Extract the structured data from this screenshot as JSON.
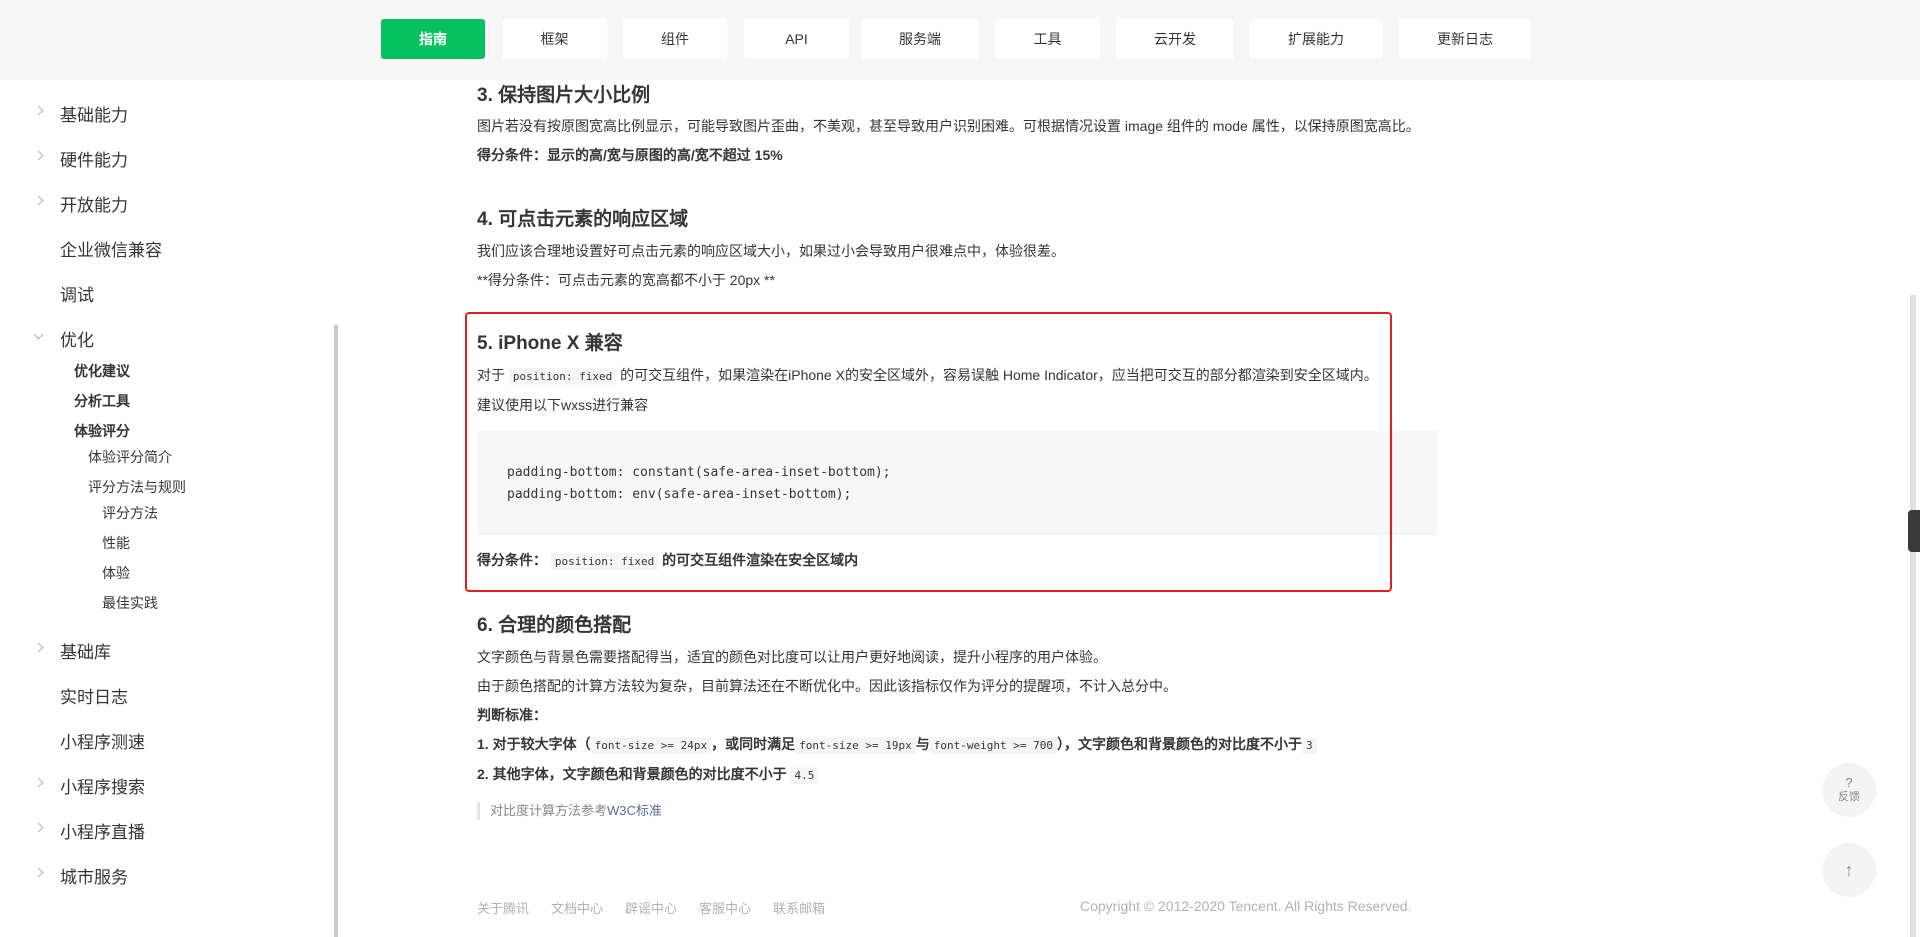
{
  "nav": {
    "items": [
      {
        "label": "指南",
        "active": true
      },
      {
        "label": "框架",
        "active": false
      },
      {
        "label": "组件",
        "active": false
      },
      {
        "label": "API",
        "active": false
      },
      {
        "label": "服务端",
        "active": false
      },
      {
        "label": "工具",
        "active": false
      },
      {
        "label": "云开发",
        "active": false
      },
      {
        "label": "扩展能力",
        "active": false
      },
      {
        "label": "更新日志",
        "active": false
      }
    ]
  },
  "sidebar": {
    "items": [
      {
        "label": "基础能力",
        "chevron": true
      },
      {
        "label": "硬件能力",
        "chevron": true
      },
      {
        "label": "开放能力",
        "chevron": true
      },
      {
        "label": "企业微信兼容",
        "chevron": false
      },
      {
        "label": "调试",
        "chevron": false
      },
      {
        "label": "优化",
        "chevron": true,
        "open": true
      },
      {
        "label": "基础库",
        "chevron": true
      },
      {
        "label": "实时日志",
        "chevron": false
      },
      {
        "label": "小程序测速",
        "chevron": false
      },
      {
        "label": "小程序搜索",
        "chevron": true
      },
      {
        "label": "小程序直播",
        "chevron": true
      },
      {
        "label": "城市服务",
        "chevron": true
      }
    ],
    "sub": {
      "optimize_advice": "优化建议",
      "analysis_tools": "分析工具",
      "experience_score": "体验评分",
      "score_intro": "体验评分简介",
      "score_methods": "评分方法与规则",
      "score_method": "评分方法",
      "performance": "性能",
      "experience": "体验",
      "best_practice": "最佳实践"
    }
  },
  "content": {
    "s3_title": "3. 保持图片大小比例",
    "s3_text": "图片若没有按原图宽高比例显示，可能导致图片歪曲，不美观，甚至导致用户识别困难。可根据情况设置 image 组件的 mode 属性，以保持原图宽高比。",
    "s3_score": "得分条件：显示的高/宽与原图的高/宽不超过 15%",
    "s4_title": "4. 可点击元素的响应区域",
    "s4_text": "我们应该合理地设置好可点击元素的响应区域大小，如果过小会导致用户很难点中，体验很差。",
    "s4_score": "**得分条件：可点击元素的宽高都不小于 20px **",
    "s5_title": "5. iPhone X 兼容",
    "s5_pre": "对于",
    "s5_code": "position: fixed",
    "s5_post": "的可交互组件，如果渲染在iPhone X的安全区域外，容易误触 Home Indicator，应当把可交互的部分都渲染到安全区域内。",
    "s5_suggest": "建议使用以下wxss进行兼容",
    "code_line1": "padding-bottom: constant(safe-area-inset-bottom);",
    "code_line2": "padding-bottom: env(safe-area-inset-bottom);",
    "s5_score_pre": "得分条件：",
    "s5_score_code": "position: fixed",
    "s5_score_post": "的可交互组件渲染在安全区域内",
    "s6_title": "6. 合理的颜色搭配",
    "s6_text1": "文字颜色与背景色需要搭配得当，适宜的颜色对比度可以让用户更好地阅读，提升小程序的用户体验。",
    "s6_text2": "由于颜色搭配的计算方法较为复杂，目前算法还在不断优化中。因此该指标仅作为评分的提醒项，不计入总分中。",
    "s6_criteria": "判断标准：",
    "c1_a": "1. 对于较大字体（",
    "c1_code1": "font-size >= 24px",
    "c1_b": "，或同时满足",
    "c1_code2": "font-size >= 19px",
    "c1_c": "与",
    "c1_code3": "font-weight >= 700",
    "c1_d": "），文字颜色和背景颜色的对比度不小于",
    "c1_code4": "3",
    "c2_a": "2. 其他字体，文字颜色和背景颜色的对比度不小于",
    "c2_code": "4.5",
    "quote_text": "对比度计算方法参考",
    "quote_link": "W3C标准"
  },
  "footer": {
    "links": [
      "关于腾讯",
      "文档中心",
      "辟谣中心",
      "客服中心",
      "联系邮箱"
    ],
    "copyright": "Copyright © 2012-2020 Tencent. All Rights Reserved."
  },
  "widgets": {
    "feedback_q": "?",
    "feedback_label": "反馈",
    "top_arrow": "↑"
  }
}
